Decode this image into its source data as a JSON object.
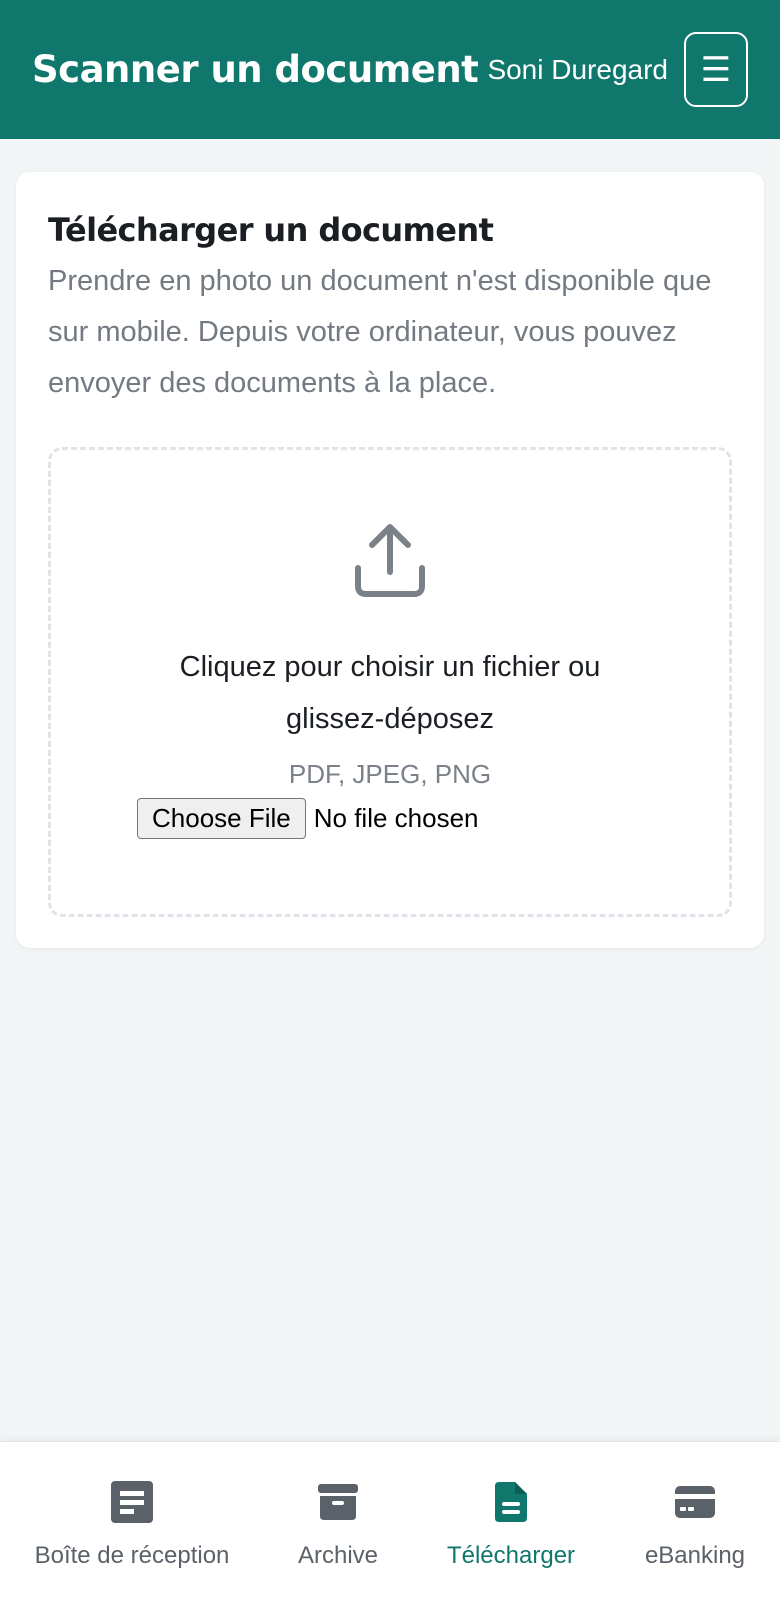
{
  "header": {
    "title": "Scanner un document",
    "user": "Soni Duregard",
    "menu_glyph": "☰"
  },
  "card": {
    "title": "Télécharger un document",
    "description": "Prendre en photo un document n'est disponible que sur mobile. Depuis votre ordinateur, vous pouvez envoyer des documents à la place.",
    "dropzone": {
      "icon": "upload-icon",
      "cta": "Cliquez pour choisir un fichier ou glissez-déposez",
      "types": "PDF, JPEG, PNG",
      "file_button": "Choose File",
      "file_status": "No file chosen"
    }
  },
  "bottom_nav": {
    "items": [
      {
        "label": "Boîte de réception",
        "icon": "inbox-document-icon",
        "active": false
      },
      {
        "label": "Archive",
        "icon": "archive-box-icon",
        "active": false
      },
      {
        "label": "Télécharger",
        "icon": "file-icon",
        "active": true
      },
      {
        "label": "eBanking",
        "icon": "credit-card-icon",
        "active": false
      }
    ]
  },
  "colors": {
    "brand": "#10776c",
    "background": "#f2f5f6",
    "muted_text": "#737a82",
    "inactive_icon": "#5b6168"
  }
}
